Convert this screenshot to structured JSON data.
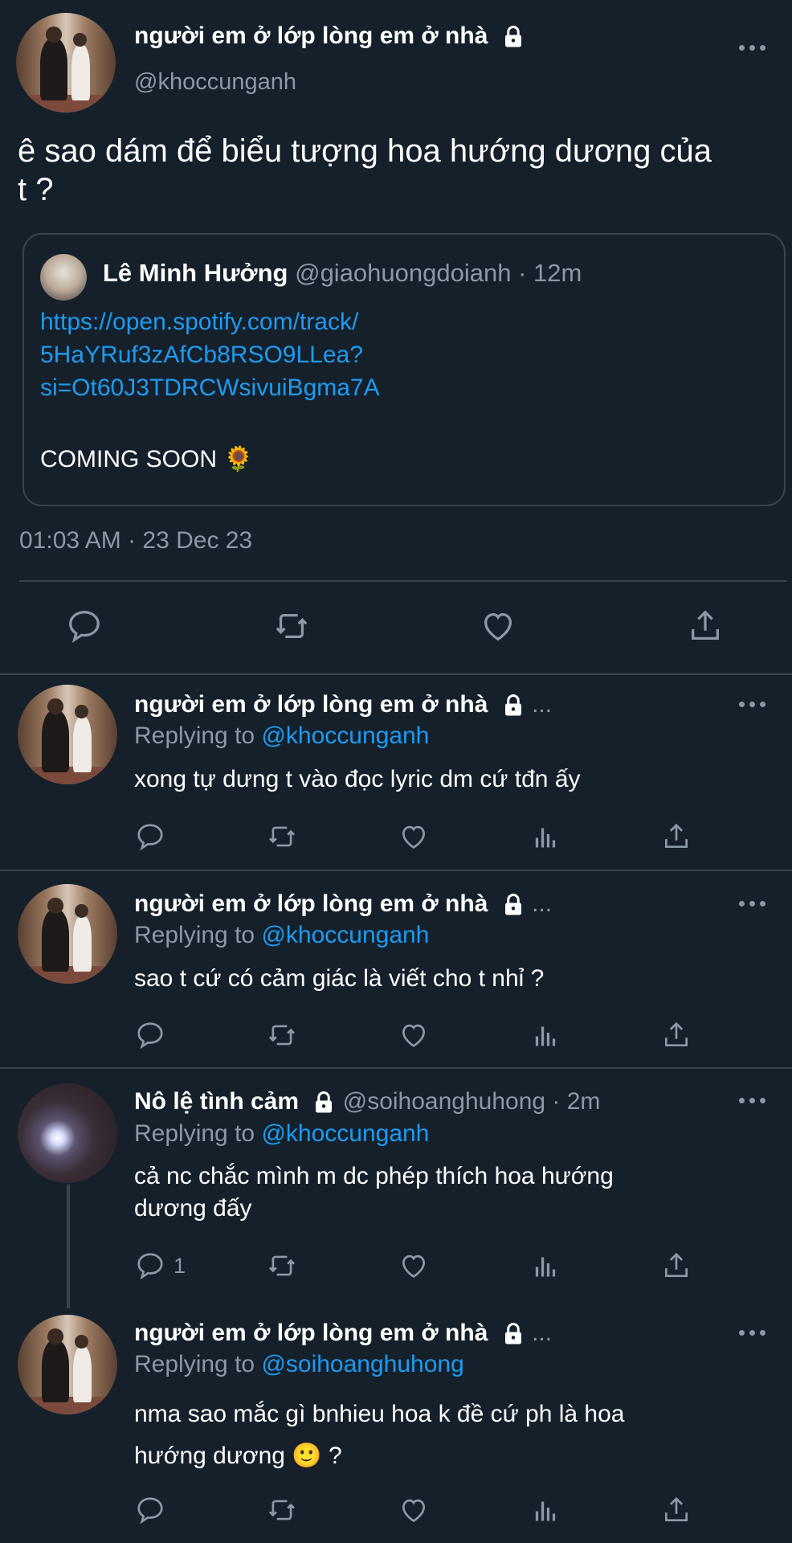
{
  "main_tweet": {
    "display_name": "người em ở lớp lòng em ở nhà",
    "handle": "@khoccunganh",
    "text_line1": "ê sao dám để biểu tượng hoa hướng dương của",
    "text_line2": "t ?",
    "quote": {
      "display_name": "Lê Minh Hưởng",
      "handle": "@giaohuongdoianh",
      "time": "· 12m",
      "link_line1": "https://open.spotify.com/track/",
      "link_line2": "5HaYRuf3zAfCb8RSO9LLea?",
      "link_line3": "si=Ot60J3TDRCWsivuiBgma7A",
      "body": "COMING SOON 🌻"
    },
    "timestamp": "01:03 AM · 23 Dec 23"
  },
  "replies": [
    {
      "display_name": "người em ở lớp lòng em ở nhà",
      "ellipsis": "...",
      "replying_prefix": "Replying to",
      "replying_to": "@khoccunganh",
      "text_line1": "xong tự dưng t vào đọc lyric dm cứ tđn ấy"
    },
    {
      "display_name": "người em ở lớp lòng em ở nhà",
      "ellipsis": "...",
      "replying_prefix": "Replying to",
      "replying_to": "@khoccunganh",
      "text_line1": "sao t cứ có cảm giác là viết cho t nhỉ ?"
    },
    {
      "display_name": "Nô lệ tình cảm",
      "handle_time": "@soihoanghuhong · 2m",
      "replying_prefix": "Replying to",
      "replying_to": "@khoccunganh",
      "text_line1": "cả nc chắc mình m dc phép thích hoa hướng",
      "text_line2": "dương đấy",
      "reply_count": "1"
    },
    {
      "display_name": "người em ở lớp lòng em ở nhà",
      "ellipsis": "...",
      "replying_prefix": "Replying to",
      "replying_to": "@soihoanghuhong",
      "text_line1": "nma sao mắc gì bnhieu hoa k đề cứ ph là hoa",
      "text_line2": "hướng dương 🙂 ?"
    }
  ],
  "icons": [
    "reply-icon",
    "retweet-icon",
    "like-icon",
    "share-icon",
    "analytics-icon",
    "more-icon",
    "lock-icon"
  ],
  "colors": {
    "background": "#15202b",
    "link": "#1d9bf0",
    "muted": "#8b98a5",
    "divider": "#38444d"
  }
}
